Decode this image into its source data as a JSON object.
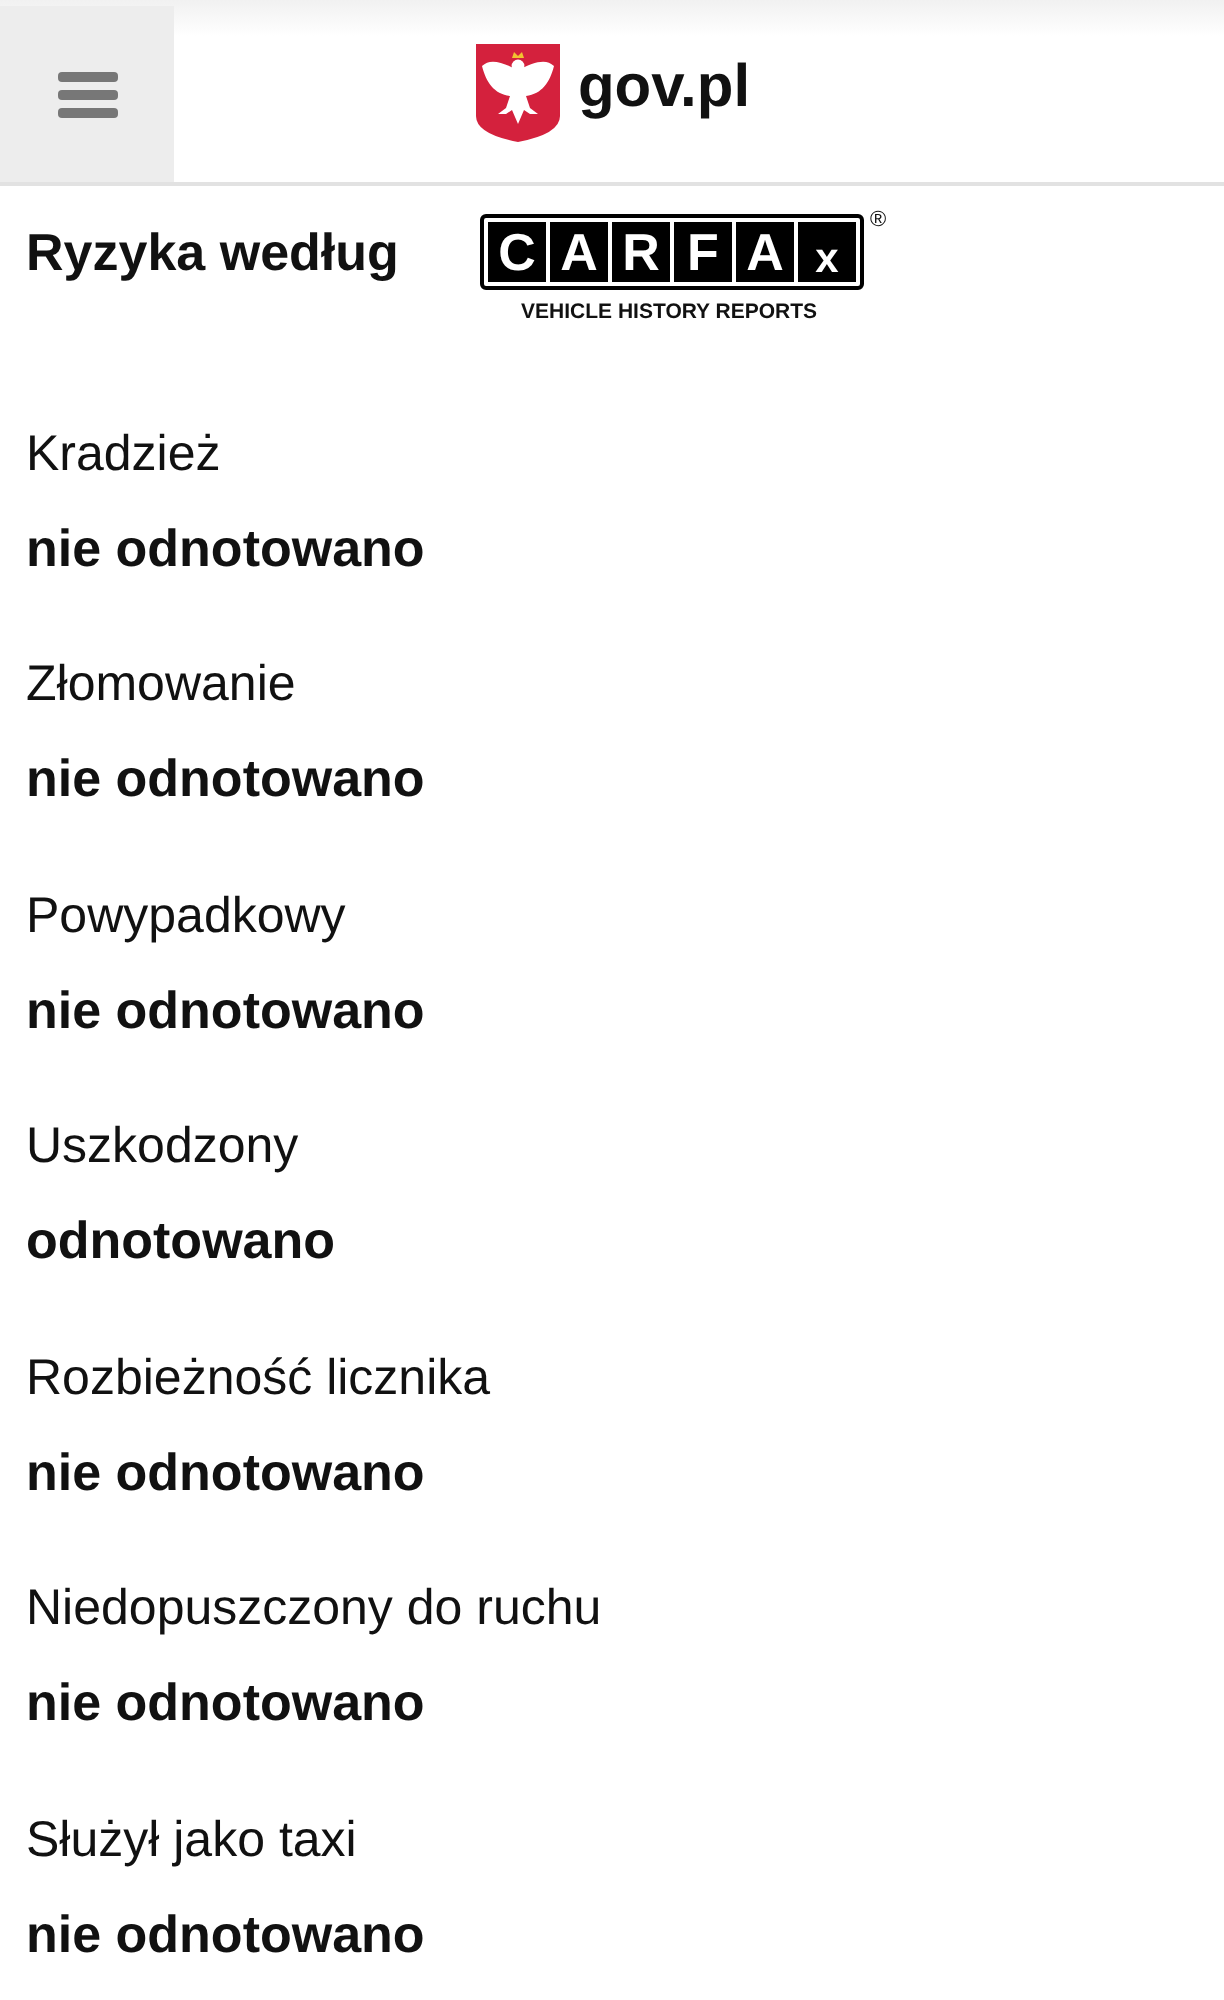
{
  "header": {
    "site_name": "gov.pl"
  },
  "section": {
    "title": "Ryzyka według",
    "logo": {
      "letters": [
        "C",
        "A",
        "R",
        "F",
        "A",
        "x"
      ],
      "mark": "®",
      "tagline": "VEHICLE HISTORY REPORTS"
    }
  },
  "risks": [
    {
      "label": "Kradzież",
      "value": "nie odnotowano"
    },
    {
      "label": "Złomowanie",
      "value": "nie odnotowano"
    },
    {
      "label": "Powypadkowy",
      "value": "nie odnotowano"
    },
    {
      "label": "Uszkodzony",
      "value": "odnotowano"
    },
    {
      "label": "Rozbieżność licznika",
      "value": "nie odnotowano"
    },
    {
      "label": "Niedopuszczony do ruchu",
      "value": "nie odnotowano"
    },
    {
      "label": "Służył jako taxi",
      "value": "nie odnotowano"
    }
  ]
}
